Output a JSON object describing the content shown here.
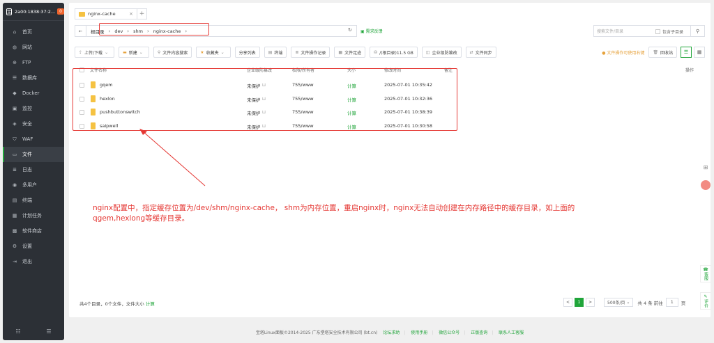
{
  "sidebar": {
    "host": "2a00:1838:37:2...",
    "badge": "0",
    "items": [
      {
        "label": "首页",
        "icon": "home-icon",
        "glyph": "⌂"
      },
      {
        "label": "网站",
        "icon": "globe-icon",
        "glyph": "◍"
      },
      {
        "label": "FTP",
        "icon": "ftp-icon",
        "glyph": "⊕"
      },
      {
        "label": "数据库",
        "icon": "database-icon",
        "glyph": "☰"
      },
      {
        "label": "Docker",
        "icon": "docker-icon",
        "glyph": "◆"
      },
      {
        "label": "监控",
        "icon": "monitor-icon",
        "glyph": "▣"
      },
      {
        "label": "安全",
        "icon": "shield-icon",
        "glyph": "◈"
      },
      {
        "label": "WAF",
        "icon": "waf-icon",
        "glyph": "⛉"
      },
      {
        "label": "文件",
        "icon": "folder-icon",
        "glyph": "▭"
      },
      {
        "label": "日志",
        "icon": "log-icon",
        "glyph": "≣"
      },
      {
        "label": "多用户",
        "icon": "users-icon",
        "glyph": "◉"
      },
      {
        "label": "终端",
        "icon": "terminal-icon",
        "glyph": "▤"
      },
      {
        "label": "计划任务",
        "icon": "calendar-icon",
        "glyph": "▦"
      },
      {
        "label": "软件商店",
        "icon": "store-icon",
        "glyph": "▩"
      },
      {
        "label": "设置",
        "icon": "settings-icon",
        "glyph": "⚙"
      },
      {
        "label": "退出",
        "icon": "logout-icon",
        "glyph": "⇥"
      }
    ],
    "active_index": 8
  },
  "tab": {
    "label": "nginx-cache",
    "close": "×",
    "add": "+"
  },
  "path": {
    "back": "←",
    "root": "根目录",
    "segments": [
      "dev",
      "shm",
      "nginx-cache"
    ],
    "refresh": "↻",
    "feedback": "需求反馈",
    "search_placeholder": "搜索文件/目录",
    "include_sub": "包含子目录",
    "search_btn": "⚲"
  },
  "toolbar": {
    "buttons": [
      "上传/下载",
      "新建",
      "文件内容搜索",
      "收藏夹",
      "分享列表",
      "终端",
      "文件操作记录",
      "文件足迹",
      "/(根目录)11.5 GB",
      "企业级防篡改",
      "文件同步"
    ],
    "warn": "文件操作可使用右键",
    "recycle": "回收站"
  },
  "table": {
    "headers": [
      "文件名称",
      "企业级防篡改",
      "权限/所有者",
      "大小",
      "修改时间",
      "备注",
      "操作"
    ],
    "rows": [
      {
        "name": "gqem",
        "protect": "未保护",
        "perm": "755/www",
        "size": "计算",
        "mtime": "2025-07-01 10:35:42"
      },
      {
        "name": "hexlon",
        "protect": "未保护",
        "perm": "755/www",
        "size": "计算",
        "mtime": "2025-07-01 10:32:36"
      },
      {
        "name": "pushbuttonswitch",
        "protect": "未保护",
        "perm": "755/www",
        "size": "计算",
        "mtime": "2025-07-01 10:38:39"
      },
      {
        "name": "saipwell",
        "protect": "未保护",
        "perm": "755/www",
        "size": "计算",
        "mtime": "2025-07-01 10:30:58"
      }
    ]
  },
  "annotation": "nginx配置中，指定缓存位置为/dev/shm/nginx-cache， shm为内存位置，重启nginx时，nginx无法自动创建在内存路径中的缓存目录，如上面的qgem,hexlong等缓存目录。",
  "footer": {
    "summary": "共4个目录，0个文件，文件大小",
    "summary_link": "计算",
    "page_prev": "<",
    "page_cur": "1",
    "page_next": ">",
    "per_page": "500条/页",
    "total": "共 4 条  前往",
    "goto": "1",
    "page_unit": "页"
  },
  "copyright": {
    "text": "宝塔Linux面板©2014-2025 广东堡塔安全技术有限公司 (bt.cn)",
    "links": [
      "论坛求助",
      "使用手册",
      "微信公众号",
      "正版查询",
      "联系人工客服"
    ]
  },
  "floats": {
    "service": "客服",
    "review": "评价"
  }
}
